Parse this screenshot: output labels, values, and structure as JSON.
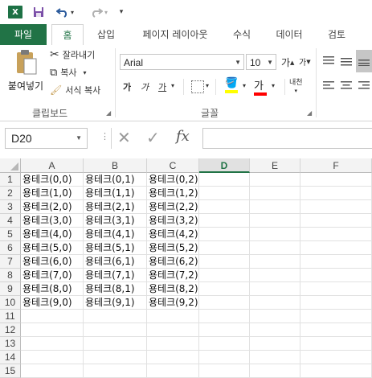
{
  "titlebar": {
    "app_icon": "X",
    "quick_access": [
      "save-icon",
      "undo-icon",
      "redo-icon",
      "customize-icon"
    ]
  },
  "tabs": [
    "파일",
    "홈",
    "삽입",
    "페이지 레이아웃",
    "수식",
    "데이터",
    "검토"
  ],
  "ribbon": {
    "clipboard": {
      "paste": "붙여넣기",
      "cut": "잘라내기",
      "copy": "복사",
      "format_painter": "서식 복사",
      "group_label": "클립보드"
    },
    "font": {
      "font_name": "Arial",
      "font_size": "10",
      "bold": "가",
      "italic": "가",
      "underline": "가",
      "font_color_sample": "가",
      "phonetic": "내천",
      "group_label": "글꼴"
    },
    "colors": {
      "accent": "#217346",
      "fill_highlight": "#ffff00",
      "font_color": "#ff0000"
    }
  },
  "formula_bar": {
    "name_box": "D20",
    "cancel": "✕",
    "enter": "✓",
    "fx": "fx",
    "value": ""
  },
  "sheet": {
    "columns": [
      "A",
      "B",
      "C",
      "D",
      "E",
      "F"
    ],
    "selected_column": "D",
    "rows": [
      {
        "n": "1",
        "cells": [
          "용테크(0,0)",
          "용테크(0,1)",
          "용테크(0,2)"
        ]
      },
      {
        "n": "2",
        "cells": [
          "용테크(1,0)",
          "용테크(1,1)",
          "용테크(1,2)"
        ]
      },
      {
        "n": "3",
        "cells": [
          "용테크(2,0)",
          "용테크(2,1)",
          "용테크(2,2)"
        ]
      },
      {
        "n": "4",
        "cells": [
          "용테크(3,0)",
          "용테크(3,1)",
          "용테크(3,2)"
        ]
      },
      {
        "n": "5",
        "cells": [
          "용테크(4,0)",
          "용테크(4,1)",
          "용테크(4,2)"
        ]
      },
      {
        "n": "6",
        "cells": [
          "용테크(5,0)",
          "용테크(5,1)",
          "용테크(5,2)"
        ]
      },
      {
        "n": "7",
        "cells": [
          "용테크(6,0)",
          "용테크(6,1)",
          "용테크(6,2)"
        ]
      },
      {
        "n": "8",
        "cells": [
          "용테크(7,0)",
          "용테크(7,1)",
          "용테크(7,2)"
        ]
      },
      {
        "n": "9",
        "cells": [
          "용테크(8,0)",
          "용테크(8,1)",
          "용테크(8,2)"
        ]
      },
      {
        "n": "10",
        "cells": [
          "용테크(9,0)",
          "용테크(9,1)",
          "용테크(9,2)"
        ]
      },
      {
        "n": "11",
        "cells": []
      },
      {
        "n": "12",
        "cells": []
      },
      {
        "n": "13",
        "cells": []
      },
      {
        "n": "14",
        "cells": []
      },
      {
        "n": "15",
        "cells": []
      }
    ]
  }
}
